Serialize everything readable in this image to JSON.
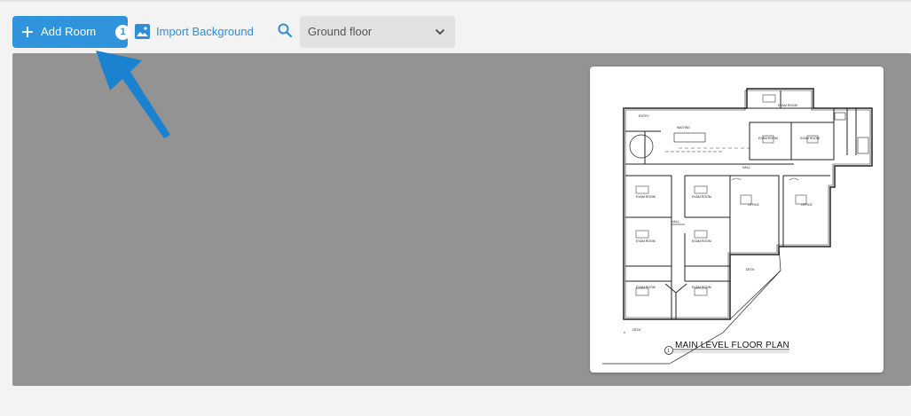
{
  "toolbar": {
    "add_room_label": "Add Room",
    "add_room_count": "1",
    "import_label": "Import Background",
    "floor_select_value": "Ground floor"
  },
  "floor_plan": {
    "title": "MAIN LEVEL FLOOR PLAN",
    "marker": "1",
    "room_labels": [
      "ENTRY",
      "WAITING",
      "EXAM ROOM",
      "EXAM ROOM",
      "EXAM ROOM",
      "HALL",
      "HALL",
      "EXAM ROOM",
      "EXAM ROOM",
      "OFFICE",
      "OFFICE",
      "EXAM ROOM",
      "EXAM ROOM",
      "EXAM ROOM",
      "EXAM ROOM",
      "DECK",
      "DECK"
    ]
  },
  "colors": {
    "accent": "#2f94db",
    "canvas": "#939393",
    "arrow": "#1a82cf"
  }
}
